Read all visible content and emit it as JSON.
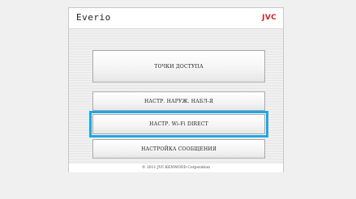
{
  "header": {
    "brand": "Everio",
    "logo": "JVC"
  },
  "menu": {
    "access_points": "ТОЧКИ ДОСТУПА",
    "outdoor_monitor": "НАСТР. НАРУЖ. НАБЛ-Я",
    "wifi_direct": "НАСТР. Wi-Fi DIRECT",
    "message_settings": "НАСТРОЙКА СООБЩЕНИЯ"
  },
  "footer": {
    "copyright": "© 2011 JVC KENWOOD Corporation"
  },
  "colors": {
    "logo": "#d11f26",
    "focus": "#1fa6e6"
  }
}
